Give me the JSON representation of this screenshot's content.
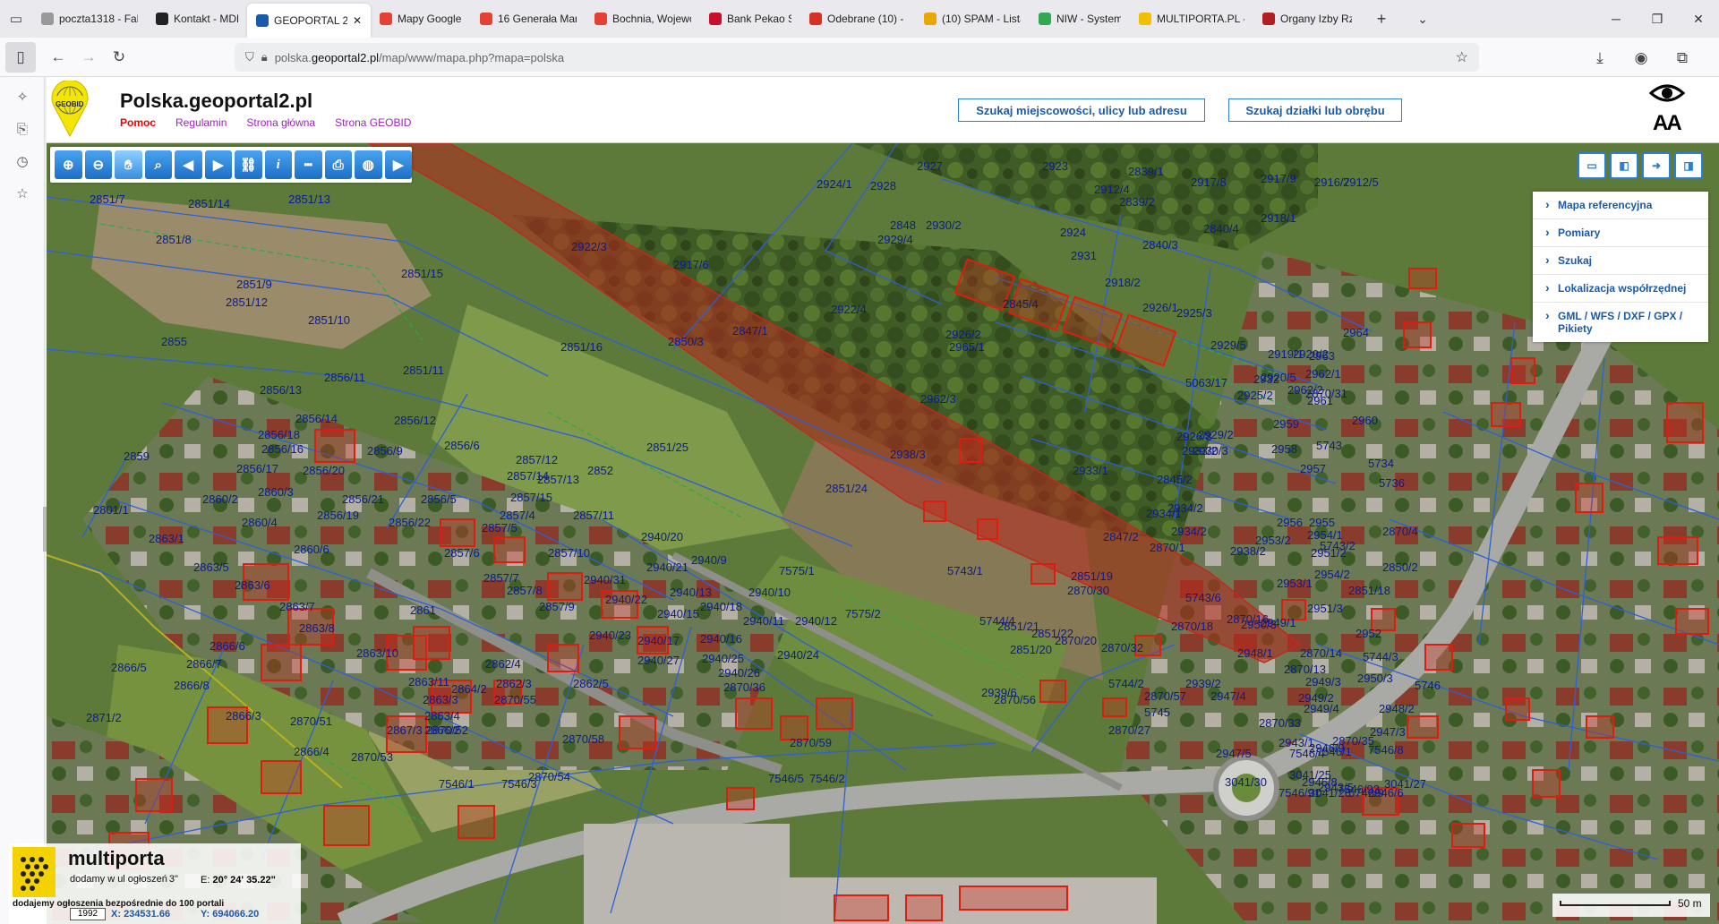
{
  "tabs": [
    {
      "label": "poczta1318 - Fakt",
      "icon": "document-icon",
      "color": "#999999"
    },
    {
      "label": "Kontakt - MDK Bo",
      "icon": "m-logo-icon",
      "color": "#222222"
    },
    {
      "label": "GEOPORTAL 2",
      "icon": "geoportal-icon",
      "color": "#1b5aa8",
      "active": true
    },
    {
      "label": "Mapy Google",
      "icon": "map-pin-icon",
      "color": "#e34133"
    },
    {
      "label": "16 Generała Mari",
      "icon": "map-pin-icon",
      "color": "#e34133"
    },
    {
      "label": "Bochnia, Wojewó",
      "icon": "map-pin-icon",
      "color": "#e34133"
    },
    {
      "label": "Bank Pekao SA",
      "icon": "pekao-icon",
      "color": "#c8102e"
    },
    {
      "label": "Odebrane (10) - c",
      "icon": "gmail-icon",
      "color": "#d93025"
    },
    {
      "label": "(10) SPAM - Lista",
      "icon": "spam-icon",
      "color": "#e8a800"
    },
    {
      "label": "NIW - System Ob",
      "icon": "niw-icon",
      "color": "#33a853"
    },
    {
      "label": "MULTIPORTA.PL -",
      "icon": "multiporta-icon",
      "color": "#f0c000"
    },
    {
      "label": "Organy Izby Rzem",
      "icon": "shield-icon",
      "color": "#b02020"
    }
  ],
  "tab_close": "✕",
  "new_tab": "+",
  "url": {
    "domain_prefix": "polska.",
    "domain": "geoportal2.pl",
    "path": "/map/www/mapa.php?mapa=polska"
  },
  "header": {
    "logo_text": "GEOBID",
    "title": "Polska.geoportal2.pl",
    "links": [
      "Pomoc",
      "Regulamin",
      "Strona główna",
      "Strona GEOBID"
    ],
    "search_address": "Szukaj miejscowości, ulicy lub adresu",
    "search_parcel": "Szukaj działki lub obrębu",
    "font_size_label": "AA"
  },
  "toolbar": [
    "zoom-in",
    "zoom-out",
    "pan",
    "zoom-box",
    "back",
    "forward",
    "link",
    "info",
    "measure",
    "print",
    "globe",
    "camera"
  ],
  "panel": [
    "Mapa referencyjna",
    "Pomiary",
    "Szukaj",
    "Lokalizacja współrzędnej",
    "GML / WFS / DXF / GPX / Pikiety"
  ],
  "parcels": [
    {
      "t": "2851/7"
    },
    {
      "t": "2851/13"
    },
    {
      "t": "2851/14"
    },
    {
      "t": "2851/8"
    },
    {
      "t": "2851/15"
    },
    {
      "t": "2851/9"
    },
    {
      "t": "2851/12"
    },
    {
      "t": "2851/10"
    },
    {
      "t": "2855"
    },
    {
      "t": "2851/16"
    },
    {
      "t": "2850/3"
    },
    {
      "t": "2847/1"
    },
    {
      "t": "2851/11"
    },
    {
      "t": "2856/11"
    },
    {
      "t": "2856/13"
    },
    {
      "t": "2856/14"
    },
    {
      "t": "2856/12"
    },
    {
      "t": "2856/16"
    },
    {
      "t": "2856/9"
    },
    {
      "t": "2856/6"
    },
    {
      "t": "2859"
    },
    {
      "t": "2856/17"
    },
    {
      "t": "2856/20"
    },
    {
      "t": "2856/18"
    },
    {
      "t": "2857/12"
    },
    {
      "t": "2857/14"
    },
    {
      "t": "2857/13"
    },
    {
      "t": "2852"
    },
    {
      "t": "2851/25"
    },
    {
      "t": "2851/24"
    },
    {
      "t": "2860/2"
    },
    {
      "t": "2860/3"
    },
    {
      "t": "2856/21"
    },
    {
      "t": "2856/5"
    },
    {
      "t": "2857/15"
    },
    {
      "t": "2801/1"
    },
    {
      "t": "2860/4"
    },
    {
      "t": "2856/19"
    },
    {
      "t": "2856/22"
    },
    {
      "t": "2857/4"
    },
    {
      "t": "2857/11"
    },
    {
      "t": "2863/1"
    },
    {
      "t": "2857/5"
    },
    {
      "t": "2860/6"
    },
    {
      "t": "2857/6"
    },
    {
      "t": "2857/10"
    },
    {
      "t": "2940/20"
    },
    {
      "t": "2863/5"
    },
    {
      "t": "2940/21"
    },
    {
      "t": "2940/9"
    },
    {
      "t": "7575/1"
    },
    {
      "t": "2863/6"
    },
    {
      "t": "2857/7"
    },
    {
      "t": "2940/31"
    },
    {
      "t": "2857/8"
    },
    {
      "t": "2940/13"
    },
    {
      "t": "2940/10"
    },
    {
      "t": "2863/7"
    },
    {
      "t": "2857/9"
    },
    {
      "t": "2940/22"
    },
    {
      "t": "2940/18"
    },
    {
      "t": "2861"
    },
    {
      "t": "2940/15"
    },
    {
      "t": "2940/11"
    },
    {
      "t": "2940/12"
    },
    {
      "t": "7575/2"
    },
    {
      "t": "2863/8"
    },
    {
      "t": "2866/6"
    },
    {
      "t": "2940/23"
    },
    {
      "t": "2940/17"
    },
    {
      "t": "2940/16"
    },
    {
      "t": "2940/24"
    },
    {
      "t": "2866/5"
    },
    {
      "t": "2866/7"
    },
    {
      "t": "2863/10"
    },
    {
      "t": "2862/4"
    },
    {
      "t": "2940/27"
    },
    {
      "t": "2940/25"
    },
    {
      "t": "2940/26"
    },
    {
      "t": "2866/8"
    },
    {
      "t": "2863/11"
    },
    {
      "t": "2862/3"
    },
    {
      "t": "2862/5"
    },
    {
      "t": "2870/36"
    },
    {
      "t": "2864/2"
    },
    {
      "t": "2863/3"
    },
    {
      "t": "2870/55"
    },
    {
      "t": "2866/3"
    },
    {
      "t": "2863/4"
    },
    {
      "t": "2870/51"
    },
    {
      "t": "2866/2"
    },
    {
      "t": "2867/3"
    },
    {
      "t": "2870/52"
    },
    {
      "t": "2870/58"
    },
    {
      "t": "2870/59"
    },
    {
      "t": "2866/4"
    },
    {
      "t": "2870/53"
    },
    {
      "t": "2871/2"
    },
    {
      "t": "7546/1"
    },
    {
      "t": "7546/3"
    },
    {
      "t": "7546/2"
    },
    {
      "t": "7546/5"
    },
    {
      "t": "2870/54"
    },
    {
      "t": "2924/1"
    },
    {
      "t": "2928"
    },
    {
      "t": "2927"
    },
    {
      "t": "2923"
    },
    {
      "t": "2839/1"
    },
    {
      "t": "2917/8"
    },
    {
      "t": "2917/9"
    },
    {
      "t": "2916/7"
    },
    {
      "t": "2912/5"
    },
    {
      "t": "2912/4"
    },
    {
      "t": "2839/2"
    },
    {
      "t": "2922/3"
    },
    {
      "t": "2848"
    },
    {
      "t": "2929/4"
    },
    {
      "t": "2930/2"
    },
    {
      "t": "2924"
    },
    {
      "t": "2840/4"
    },
    {
      "t": "2918/1"
    },
    {
      "t": "2917/6"
    },
    {
      "t": "2931"
    },
    {
      "t": "2840/3"
    },
    {
      "t": "2918/2"
    },
    {
      "t": "2922/4"
    },
    {
      "t": "2845/4"
    },
    {
      "t": "2926/1"
    },
    {
      "t": "2926/2"
    },
    {
      "t": "2925/3"
    },
    {
      "t": "2919/1"
    },
    {
      "t": "2963"
    },
    {
      "t": "2964"
    },
    {
      "t": "2965/1"
    },
    {
      "t": "2929/5"
    },
    {
      "t": "2920/2"
    },
    {
      "t": "2920/5"
    },
    {
      "t": "2962/1"
    },
    {
      "t": "2962/2"
    },
    {
      "t": "2962/3"
    },
    {
      "t": "2932"
    },
    {
      "t": "2870/31"
    },
    {
      "t": "5063/17"
    },
    {
      "t": "2925/2"
    },
    {
      "t": "2959"
    },
    {
      "t": "2961"
    },
    {
      "t": "2960"
    },
    {
      "t": "2926/3"
    },
    {
      "t": "2958"
    },
    {
      "t": "5743"
    },
    {
      "t": "2929/2"
    },
    {
      "t": "2930/3"
    },
    {
      "t": "2933/2"
    },
    {
      "t": "2938/3"
    },
    {
      "t": "2957"
    },
    {
      "t": "5734"
    },
    {
      "t": "2933/1"
    },
    {
      "t": "2845/2"
    },
    {
      "t": "5736"
    },
    {
      "t": "2934/1"
    },
    {
      "t": "2934/2"
    },
    {
      "t": "2934/2"
    },
    {
      "t": "2956"
    },
    {
      "t": "2954/1"
    },
    {
      "t": "2955"
    },
    {
      "t": "2847/2"
    },
    {
      "t": "2953/2"
    },
    {
      "t": "2870/1"
    },
    {
      "t": "2870/4"
    },
    {
      "t": "5743/1"
    },
    {
      "t": "2851/19"
    },
    {
      "t": "2938/2"
    },
    {
      "t": "2954/2"
    },
    {
      "t": "5743/2"
    },
    {
      "t": "2850/2"
    },
    {
      "t": "2951/2"
    },
    {
      "t": "2870/30"
    },
    {
      "t": "2953/1"
    },
    {
      "t": "5743/6"
    },
    {
      "t": "2851/18"
    },
    {
      "t": "2950/3"
    },
    {
      "t": "5744/4"
    },
    {
      "t": "2851/21"
    },
    {
      "t": "2851/22"
    },
    {
      "t": "2870/18"
    },
    {
      "t": "2870/16"
    },
    {
      "t": "2949/1"
    },
    {
      "t": "2951/3"
    },
    {
      "t": "2851/20"
    },
    {
      "t": "2870/20"
    },
    {
      "t": "2952"
    },
    {
      "t": "5744/3"
    },
    {
      "t": "2870/32"
    },
    {
      "t": "2948/1"
    },
    {
      "t": "2870/14"
    },
    {
      "t": "2950/3"
    },
    {
      "t": "5744/2"
    },
    {
      "t": "2939/2"
    },
    {
      "t": "2870/13"
    },
    {
      "t": "2949/3"
    },
    {
      "t": "2949/2"
    },
    {
      "t": "5746"
    },
    {
      "t": "2939/6"
    },
    {
      "t": "2870/56"
    },
    {
      "t": "2870/57"
    },
    {
      "t": "2947/4"
    },
    {
      "t": "2949/4"
    },
    {
      "t": "2948/2"
    },
    {
      "t": "5745"
    },
    {
      "t": "2870/27"
    },
    {
      "t": "2870/33"
    },
    {
      "t": "2947/3"
    },
    {
      "t": "2870/35"
    },
    {
      "t": "7546/1"
    },
    {
      "t": "2947/5"
    },
    {
      "t": "7546/4"
    },
    {
      "t": "7546/8"
    },
    {
      "t": "7546/91"
    },
    {
      "t": "7546/93"
    },
    {
      "t": "3041/27"
    },
    {
      "t": "2946/6"
    },
    {
      "t": "5746/9"
    },
    {
      "t": "2946/9"
    },
    {
      "t": "3041/25"
    },
    {
      "t": "3041/26"
    },
    {
      "t": "3041/30"
    },
    {
      "t": "2946/8"
    },
    {
      "t": "2943/1"
    },
    {
      "t": "2943/5"
    }
  ],
  "promo": {
    "name": "multiporta",
    "line1": "dodamy w ul ogłoszeń",
    "line2": "dodajemy ogłoszenia bezpośrednie do 100 portali",
    "coord_e_label": "E:",
    "coord_e": "20° 24' 35.22\"",
    "coord_n_suffix": "3\"",
    "x_label": "X:",
    "x_value": "234531.66",
    "y_label": "Y:",
    "y_value": "694066.20",
    "epsg": "1992"
  },
  "scale": {
    "label": "50 m"
  }
}
